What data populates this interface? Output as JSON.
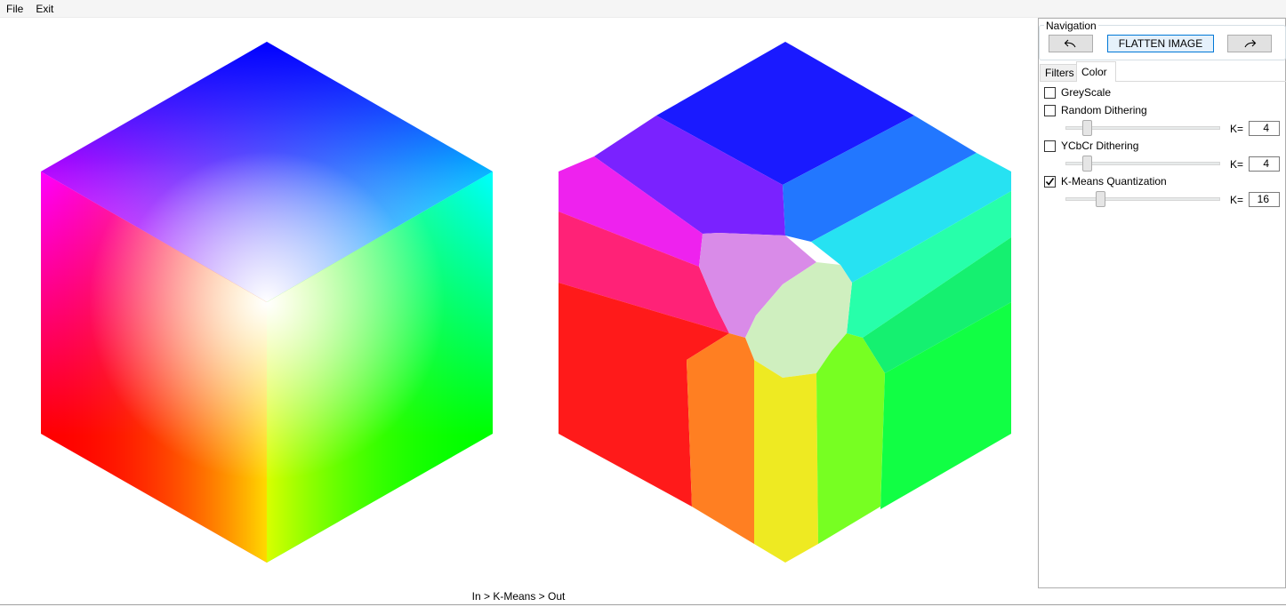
{
  "menu": {
    "items": [
      "File",
      "Exit"
    ]
  },
  "status": {
    "pipeline": "In > K-Means > Out"
  },
  "navigation": {
    "legend": "Navigation",
    "undo_icon": "undo-arrow-icon",
    "redo_icon": "redo-arrow-icon",
    "flatten_label": "FLATTEN IMAGE"
  },
  "tabs": [
    {
      "label": "Filters",
      "active": false
    },
    {
      "label": "Color",
      "active": true
    }
  ],
  "options": {
    "greyscale": {
      "label": "GreyScale",
      "checked": false
    },
    "random_dithering": {
      "label": "Random Dithering",
      "checked": false,
      "k_label": "K=",
      "k_value": "4"
    },
    "ycbcr_dithering": {
      "label": "YCbCr Dithering",
      "checked": false,
      "k_label": "K=",
      "k_value": "4"
    },
    "kmeans": {
      "label": "K-Means Quantization",
      "checked": true,
      "k_label": "K=",
      "k_value": "16"
    }
  },
  "colors": {
    "accent": "#0078d7",
    "button_face": "#e1e1e1",
    "flatten_bg": "#e5f1fb"
  }
}
